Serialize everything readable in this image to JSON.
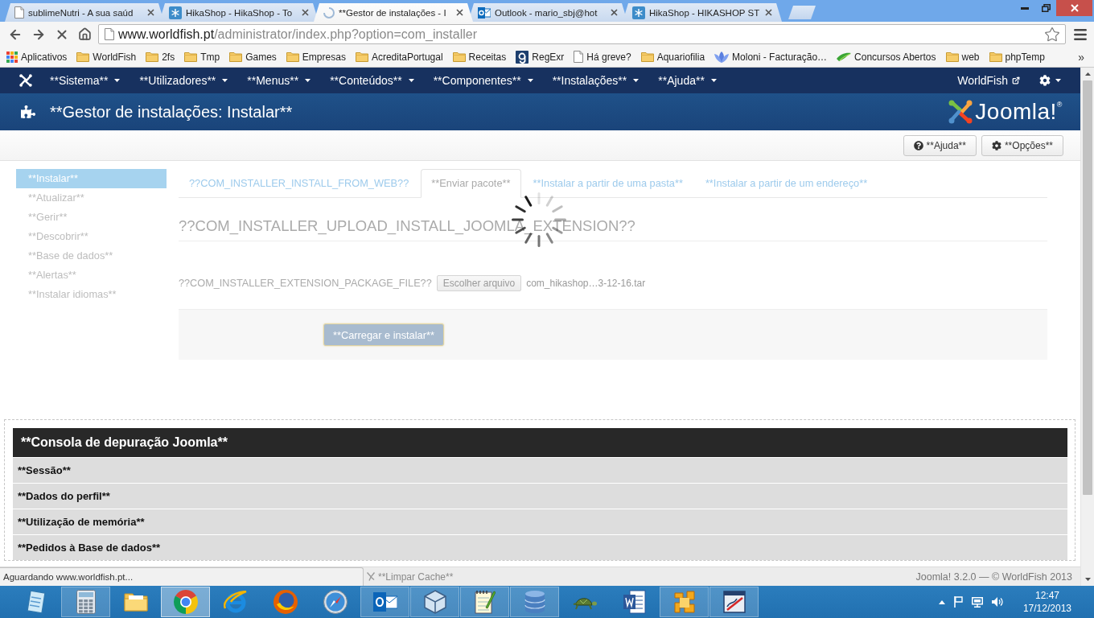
{
  "browser": {
    "tabs": [
      {
        "title": "sublimeNutri - A sua saúd",
        "kind": "page",
        "selected": false
      },
      {
        "title": "HikaShop - HikaShop - To",
        "kind": "snowflake",
        "selected": false
      },
      {
        "title": "**Gestor de instalações - I",
        "kind": "loading",
        "selected": true
      },
      {
        "title": "Outlook - mario_sbj@hot",
        "kind": "mail",
        "selected": false
      },
      {
        "title": "HikaShop - HIKASHOP ST",
        "kind": "snowflake",
        "selected": false
      }
    ],
    "address": {
      "host": "www.worldfish.pt",
      "path": "/administrator/index.php?option=com_installer"
    },
    "bookmarks": [
      {
        "label": "Aplicativos",
        "kind": "apps"
      },
      {
        "label": "WorldFish",
        "kind": "folder"
      },
      {
        "label": "2fs",
        "kind": "folder"
      },
      {
        "label": "Tmp",
        "kind": "folder"
      },
      {
        "label": "Games",
        "kind": "folder"
      },
      {
        "label": "Empresas",
        "kind": "folder"
      },
      {
        "label": "AcreditaPortugal",
        "kind": "folder"
      },
      {
        "label": "Receitas",
        "kind": "folder"
      },
      {
        "label": "RegExr",
        "kind": "tile"
      },
      {
        "label": "Há greve?",
        "kind": "page"
      },
      {
        "label": "Aquariofilia",
        "kind": "folder"
      },
      {
        "label": "Moloni - Facturação…",
        "kind": "flower"
      },
      {
        "label": "Concursos Abertos",
        "kind": "leaf"
      },
      {
        "label": "web",
        "kind": "folder"
      },
      {
        "label": "phpTemp",
        "kind": "folder"
      }
    ],
    "bookmarks_overflow": "»",
    "status_bubble": "Aguardando www.worldfish.pt..."
  },
  "joomla": {
    "menu": [
      "**Sistema**",
      "**Utilizadores**",
      "**Menus**",
      "**Conteúdos**",
      "**Componentes**",
      "**Instalações**",
      "**Ajuda**"
    ],
    "site_link": "WorldFish",
    "page_title": "**Gestor de instalações: Instalar**",
    "brand": "Joomla!$^{®}$",
    "toolbar": [
      {
        "label": "**Ajuda**",
        "kind": "help"
      },
      {
        "label": "**Opções**",
        "kind": "gear"
      }
    ],
    "sidebar": [
      {
        "label": "**Instalar**",
        "selected": true
      },
      {
        "label": "**Atualizar**",
        "selected": false
      },
      {
        "label": "**Gerir**",
        "selected": false
      },
      {
        "label": "**Descobrir**",
        "selected": false
      },
      {
        "label": "**Base de dados**",
        "selected": false
      },
      {
        "label": "**Alertas**",
        "selected": false
      },
      {
        "label": "**Instalar idiomas**",
        "selected": false
      }
    ],
    "tabs": [
      {
        "label": "??COM_INSTALLER_INSTALL_FROM_WEB??",
        "selected": false
      },
      {
        "label": "**Enviar pacote**",
        "selected": true
      },
      {
        "label": "**Instalar a partir de uma pasta**",
        "selected": false
      },
      {
        "label": "**Instalar a partir de um endereço**",
        "selected": false
      }
    ],
    "heading": "??COM_INSTALLER_UPLOAD_INSTALL_JOOMLA_EXTENSION??",
    "package_field": {
      "label": "??COM_INSTALLER_EXTENSION_PACKAGE_FILE??",
      "button": "Escolher arquivo",
      "file": "com_hikashop…3-12-16.tar"
    },
    "submit": "**Carregar e instalar**",
    "debug": {
      "title": "**Consola de depuração Joomla**",
      "sections": [
        "**Sessão**",
        "**Dados do perfil**",
        "**Utilização de memória**",
        "**Pedidos à Base de dados**"
      ]
    },
    "footer": {
      "clear_cache": "**Limpar Cache**",
      "copyright": "Joomla! 3.2.0 — © WorldFish 2013"
    }
  },
  "taskbar": {
    "apps": [
      {
        "kind": "notepad",
        "running": false,
        "selected": false
      },
      {
        "kind": "calculator",
        "running": true,
        "selected": false
      },
      {
        "kind": "folder",
        "running": false,
        "selected": false
      },
      {
        "kind": "browser",
        "running": true,
        "selected": true
      },
      {
        "kind": "ring",
        "running": false,
        "selected": false
      },
      {
        "kind": "globe",
        "running": false,
        "selected": false
      },
      {
        "kind": "compass",
        "running": false,
        "selected": false
      },
      {
        "kind": "mail",
        "running": true,
        "selected": false
      },
      {
        "kind": "cube",
        "running": true,
        "selected": false
      },
      {
        "kind": "notebook",
        "running": true,
        "selected": false
      },
      {
        "kind": "database",
        "running": true,
        "selected": false
      },
      {
        "kind": "turtle",
        "running": false,
        "selected": false
      },
      {
        "kind": "document",
        "running": false,
        "selected": false
      },
      {
        "kind": "blocks",
        "running": true,
        "selected": false
      },
      {
        "kind": "sketch",
        "running": true,
        "selected": false
      }
    ],
    "time": "12:47",
    "date": "17/12/2013"
  }
}
